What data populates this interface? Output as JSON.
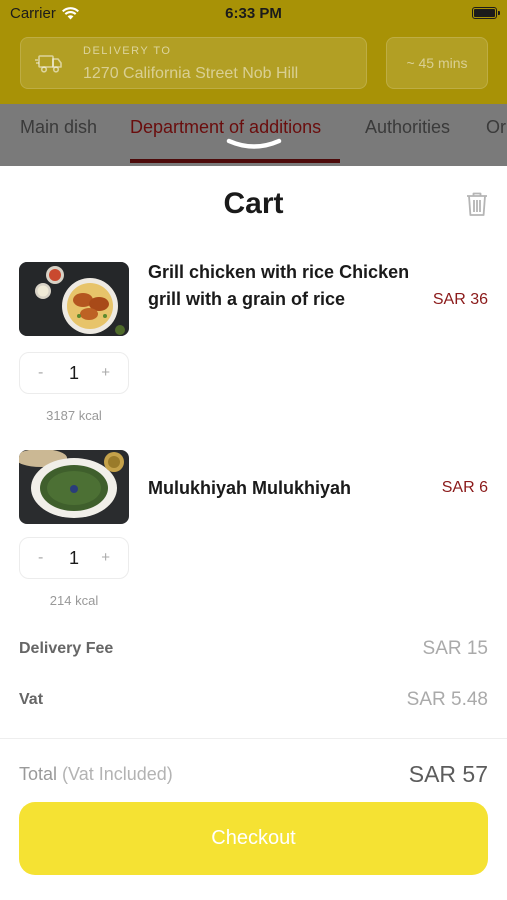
{
  "status_bar": {
    "carrier": "Carrier",
    "time": "6:33 PM"
  },
  "header": {
    "delivery_label": "DELIVERY TO",
    "delivery_address": "1270 California Street Nob Hill",
    "eta": "~ 45 mins"
  },
  "tabs": [
    {
      "label": "Main dish"
    },
    {
      "label": "Department of additions",
      "active": true
    },
    {
      "label": "Authorities"
    },
    {
      "label": "Or"
    }
  ],
  "cart": {
    "title": "Cart",
    "items": [
      {
        "name": "Grill chicken with rice Chicken grill with a grain of rice",
        "price": "SAR 36",
        "quantity": "1",
        "kcal": "3187 kcal",
        "minus": "-",
        "plus": "+"
      },
      {
        "name": "Mulukhiyah Mulukhiyah",
        "price": "SAR 6",
        "quantity": "1",
        "kcal": "214 kcal",
        "minus": "-",
        "plus": "+"
      }
    ],
    "delivery_fee_label": "Delivery Fee",
    "delivery_fee_value": "SAR 15",
    "vat_label": "Vat",
    "vat_value": "SAR 5.48",
    "total_label": "Total",
    "total_sub": "(Vat Included)",
    "total_value": "SAR 57",
    "checkout_label": "Checkout"
  },
  "colors": {
    "accent_yellow": "#f5e233",
    "price_red": "#8b1a1a",
    "header_dimmed": "#a89206"
  },
  "icons": [
    "wifi-icon",
    "battery-icon",
    "truck-icon",
    "chevron-down-icon",
    "trash-icon"
  ]
}
